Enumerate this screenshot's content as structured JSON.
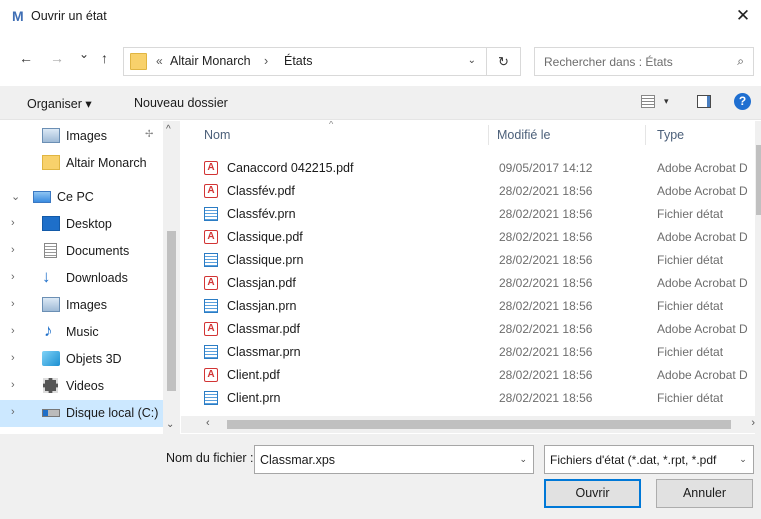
{
  "window": {
    "app_icon": "M",
    "title": "Ouvrir un état",
    "close_glyph": "✕"
  },
  "nav": {
    "back": "←",
    "forward": "→",
    "recent": "⌄",
    "up": "↑",
    "path_overflow": "«",
    "crumbs": [
      "Altair Monarch",
      "États"
    ],
    "crumb_sep": "›",
    "address_dropdown": "⌄",
    "refresh": "↻",
    "search_placeholder": "Rechercher dans : États",
    "search_glyph": "⌕"
  },
  "toolbar": {
    "organise": "Organiser ▾",
    "new_folder": "Nouveau dossier",
    "view_dropdown": "▾",
    "help": "?"
  },
  "navpane": {
    "items": [
      {
        "label": "Images",
        "icon": "pictures-icon",
        "pinned": true,
        "chevron": ""
      },
      {
        "label": "Altair Monarch",
        "icon": "folder-icon",
        "pinned": false,
        "chevron": ""
      },
      {
        "label": "Ce PC",
        "icon": "pc-icon",
        "pinned": false,
        "chevron": "⌄"
      },
      {
        "label": "Desktop",
        "icon": "desktop-icon",
        "pinned": false,
        "chevron": "›"
      },
      {
        "label": "Documents",
        "icon": "documents-icon",
        "pinned": false,
        "chevron": "›"
      },
      {
        "label": "Downloads",
        "icon": "downloads-icon",
        "pinned": false,
        "chevron": "›"
      },
      {
        "label": "Images",
        "icon": "pictures-icon",
        "pinned": false,
        "chevron": "›"
      },
      {
        "label": "Music",
        "icon": "music-icon",
        "pinned": false,
        "chevron": "›"
      },
      {
        "label": "Objets 3D",
        "icon": "objects3d-icon",
        "pinned": false,
        "chevron": "›"
      },
      {
        "label": "Videos",
        "icon": "videos-icon",
        "pinned": false,
        "chevron": "›"
      },
      {
        "label": "Disque local (C:)",
        "icon": "drive-icon",
        "pinned": false,
        "chevron": "›",
        "selected": true
      }
    ],
    "pin_glyph": "📌"
  },
  "filelist": {
    "columns": {
      "name": "Nom",
      "modified": "Modifié le",
      "type": "Type"
    },
    "sort_glyph": "^",
    "files": [
      {
        "name": "Canaccord 042215.pdf",
        "date": "09/05/2017 14:12",
        "type": "Adobe Acrobat D",
        "kind": "pdf"
      },
      {
        "name": "Classfév.pdf",
        "date": "28/02/2021 18:56",
        "type": "Adobe Acrobat D",
        "kind": "pdf"
      },
      {
        "name": "Classfév.prn",
        "date": "28/02/2021 18:56",
        "type": "Fichier détat",
        "kind": "prn"
      },
      {
        "name": "Classique.pdf",
        "date": "28/02/2021 18:56",
        "type": "Adobe Acrobat D",
        "kind": "pdf"
      },
      {
        "name": "Classique.prn",
        "date": "28/02/2021 18:56",
        "type": "Fichier détat",
        "kind": "prn"
      },
      {
        "name": "Classjan.pdf",
        "date": "28/02/2021 18:56",
        "type": "Adobe Acrobat D",
        "kind": "pdf"
      },
      {
        "name": "Classjan.prn",
        "date": "28/02/2021 18:56",
        "type": "Fichier détat",
        "kind": "prn"
      },
      {
        "name": "Classmar.pdf",
        "date": "28/02/2021 18:56",
        "type": "Adobe Acrobat D",
        "kind": "pdf"
      },
      {
        "name": "Classmar.prn",
        "date": "28/02/2021 18:56",
        "type": "Fichier détat",
        "kind": "prn"
      },
      {
        "name": "Client.pdf",
        "date": "28/02/2021 18:56",
        "type": "Adobe Acrobat D",
        "kind": "pdf"
      },
      {
        "name": "Client.prn",
        "date": "28/02/2021 18:56",
        "type": "Fichier détat",
        "kind": "prn"
      }
    ]
  },
  "footer": {
    "filename_label": "Nom du fichier :",
    "filename_value": "Classmar.xps",
    "filetype_value": "Fichiers d'état (*.dat, *.rpt, *.pdf",
    "dropdown": "⌄",
    "open_label": "Ouvrir",
    "cancel_label": "Annuler"
  },
  "colors": {
    "accent": "#0078d7",
    "selection": "#cce8ff",
    "pdf_red": "#d23434"
  }
}
